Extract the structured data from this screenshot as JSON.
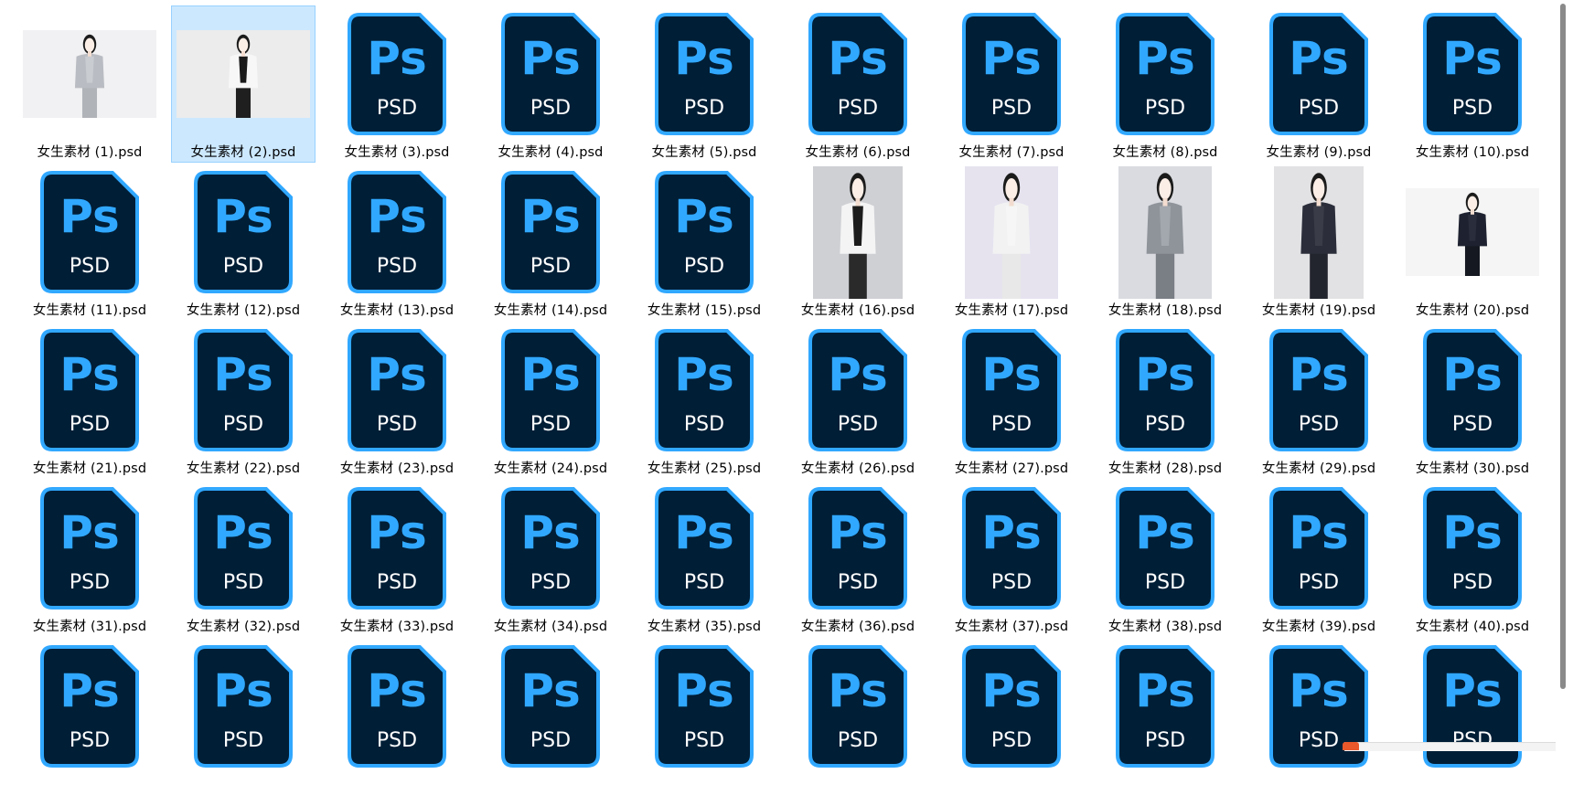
{
  "explorer": {
    "selected_index": 1,
    "columns": 10,
    "colors": {
      "selection_bg": "#cce8ff",
      "selection_border": "#99d1ff",
      "ps_bg": "#001e36",
      "ps_accent": "#31a8ff",
      "ps_label_text": "#ffffff"
    },
    "ps_icon": {
      "glyph": "Ps",
      "type_label": "PSD"
    },
    "files": [
      {
        "name": "女生素材 (1).psd",
        "thumb": "photo"
      },
      {
        "name": "女生素材 (2).psd",
        "thumb": "photo"
      },
      {
        "name": "女生素材 (3).psd",
        "thumb": "ps-icon"
      },
      {
        "name": "女生素材 (4).psd",
        "thumb": "ps-icon"
      },
      {
        "name": "女生素材 (5).psd",
        "thumb": "ps-icon"
      },
      {
        "name": "女生素材 (6).psd",
        "thumb": "ps-icon"
      },
      {
        "name": "女生素材 (7).psd",
        "thumb": "ps-icon"
      },
      {
        "name": "女生素材 (8).psd",
        "thumb": "ps-icon"
      },
      {
        "name": "女生素材 (9).psd",
        "thumb": "ps-icon"
      },
      {
        "name": "女生素材 (10).psd",
        "thumb": "ps-icon"
      },
      {
        "name": "女生素材 (11).psd",
        "thumb": "ps-icon"
      },
      {
        "name": "女生素材 (12).psd",
        "thumb": "ps-icon"
      },
      {
        "name": "女生素材 (13).psd",
        "thumb": "ps-icon"
      },
      {
        "name": "女生素材 (14).psd",
        "thumb": "ps-icon"
      },
      {
        "name": "女生素材 (15).psd",
        "thumb": "ps-icon"
      },
      {
        "name": "女生素材 (16).psd",
        "thumb": "photo"
      },
      {
        "name": "女生素材 (17).psd",
        "thumb": "photo"
      },
      {
        "name": "女生素材 (18).psd",
        "thumb": "photo"
      },
      {
        "name": "女生素材 (19).psd",
        "thumb": "photo"
      },
      {
        "name": "女生素材 (20).psd",
        "thumb": "photo"
      },
      {
        "name": "女生素材 (21).psd",
        "thumb": "ps-icon"
      },
      {
        "name": "女生素材 (22).psd",
        "thumb": "ps-icon"
      },
      {
        "name": "女生素材 (23).psd",
        "thumb": "ps-icon"
      },
      {
        "name": "女生素材 (24).psd",
        "thumb": "ps-icon"
      },
      {
        "name": "女生素材 (25).psd",
        "thumb": "ps-icon"
      },
      {
        "name": "女生素材 (26).psd",
        "thumb": "ps-icon"
      },
      {
        "name": "女生素材 (27).psd",
        "thumb": "ps-icon"
      },
      {
        "name": "女生素材 (28).psd",
        "thumb": "ps-icon"
      },
      {
        "name": "女生素材 (29).psd",
        "thumb": "ps-icon"
      },
      {
        "name": "女生素材 (30).psd",
        "thumb": "ps-icon"
      },
      {
        "name": "女生素材 (31).psd",
        "thumb": "ps-icon"
      },
      {
        "name": "女生素材 (32).psd",
        "thumb": "ps-icon"
      },
      {
        "name": "女生素材 (33).psd",
        "thumb": "ps-icon"
      },
      {
        "name": "女生素材 (34).psd",
        "thumb": "ps-icon"
      },
      {
        "name": "女生素材 (35).psd",
        "thumb": "ps-icon"
      },
      {
        "name": "女生素材 (36).psd",
        "thumb": "ps-icon"
      },
      {
        "name": "女生素材 (37).psd",
        "thumb": "ps-icon"
      },
      {
        "name": "女生素材 (38).psd",
        "thumb": "ps-icon"
      },
      {
        "name": "女生素材 (39).psd",
        "thumb": "ps-icon"
      },
      {
        "name": "女生素材 (40).psd",
        "thumb": "ps-icon"
      },
      {
        "name": "",
        "thumb": "ps-icon"
      },
      {
        "name": "",
        "thumb": "ps-icon"
      },
      {
        "name": "",
        "thumb": "ps-icon"
      },
      {
        "name": "",
        "thumb": "ps-icon"
      },
      {
        "name": "",
        "thumb": "ps-icon"
      },
      {
        "name": "",
        "thumb": "ps-icon"
      },
      {
        "name": "",
        "thumb": "ps-icon"
      },
      {
        "name": "",
        "thumb": "ps-icon"
      },
      {
        "name": "",
        "thumb": "ps-icon"
      },
      {
        "name": "",
        "thumb": "ps-icon"
      }
    ]
  }
}
